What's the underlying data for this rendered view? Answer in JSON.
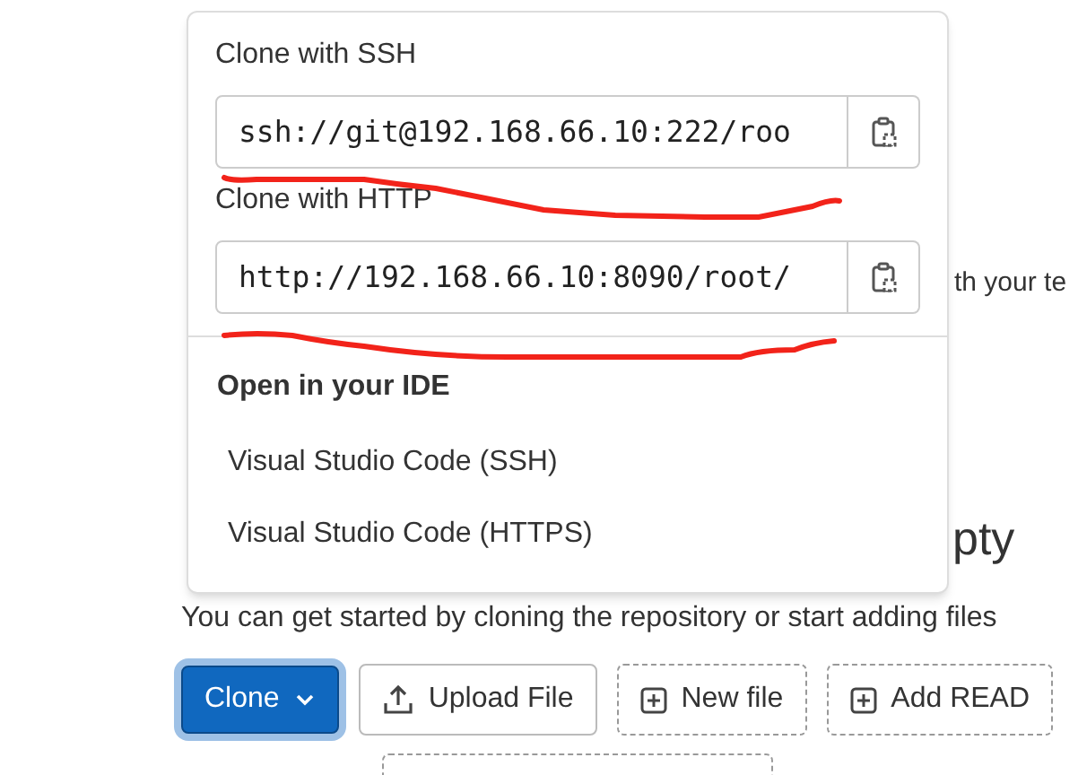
{
  "background": {
    "fragment": "th your te",
    "heading": "pty",
    "paragraph": "You can get started by cloning the repository or start adding files"
  },
  "buttons": [
    {
      "label": "Clone",
      "kind": "primary",
      "expanded": true
    },
    {
      "label": "Upload File",
      "kind": "upload"
    },
    {
      "label": "New file",
      "kind": "dashed"
    },
    {
      "label": "Add READ",
      "kind": "dashed"
    }
  ],
  "dropdown": {
    "clone_options": [
      {
        "title": "Clone with SSH",
        "value": "ssh://git@192.168.66.10:222/roo"
      },
      {
        "title": "Clone with HTTP",
        "value": "http://192.168.66.10:8090/root/"
      }
    ],
    "ide_title": "Open in your IDE",
    "ide_items": [
      "Visual Studio Code (SSH)",
      "Visual Studio Code (HTTPS)"
    ]
  }
}
